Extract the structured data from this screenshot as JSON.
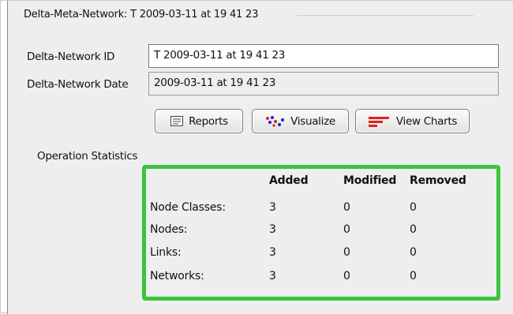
{
  "group": {
    "title": "Delta-Meta-Network: T 2009-03-11 at 19 41 23"
  },
  "form": {
    "id_label": "Delta-Network ID",
    "id_value": "T 2009-03-11 at 19 41 23",
    "date_label": "Delta-Network Date",
    "date_value": "2009-03-11 at 19 41 23"
  },
  "buttons": {
    "reports": {
      "label": "Reports",
      "icon": "document-icon"
    },
    "visualize": {
      "label": "Visualize",
      "icon": "network-dots-icon"
    },
    "view_charts": {
      "label": "View Charts",
      "icon": "chart-bars-icon"
    }
  },
  "stats": {
    "title": "Operation Statistics",
    "columns": [
      "Added",
      "Modified",
      "Removed"
    ],
    "rows": [
      {
        "label": "Node Classes:",
        "values": [
          "3",
          "0",
          "0"
        ]
      },
      {
        "label": "Nodes:",
        "values": [
          "3",
          "0",
          "0"
        ]
      },
      {
        "label": "Links:",
        "values": [
          "3",
          "0",
          "0"
        ]
      },
      {
        "label": "Networks:",
        "values": [
          "3",
          "0",
          "0"
        ]
      }
    ],
    "highlight_color": "#3cc43c"
  }
}
